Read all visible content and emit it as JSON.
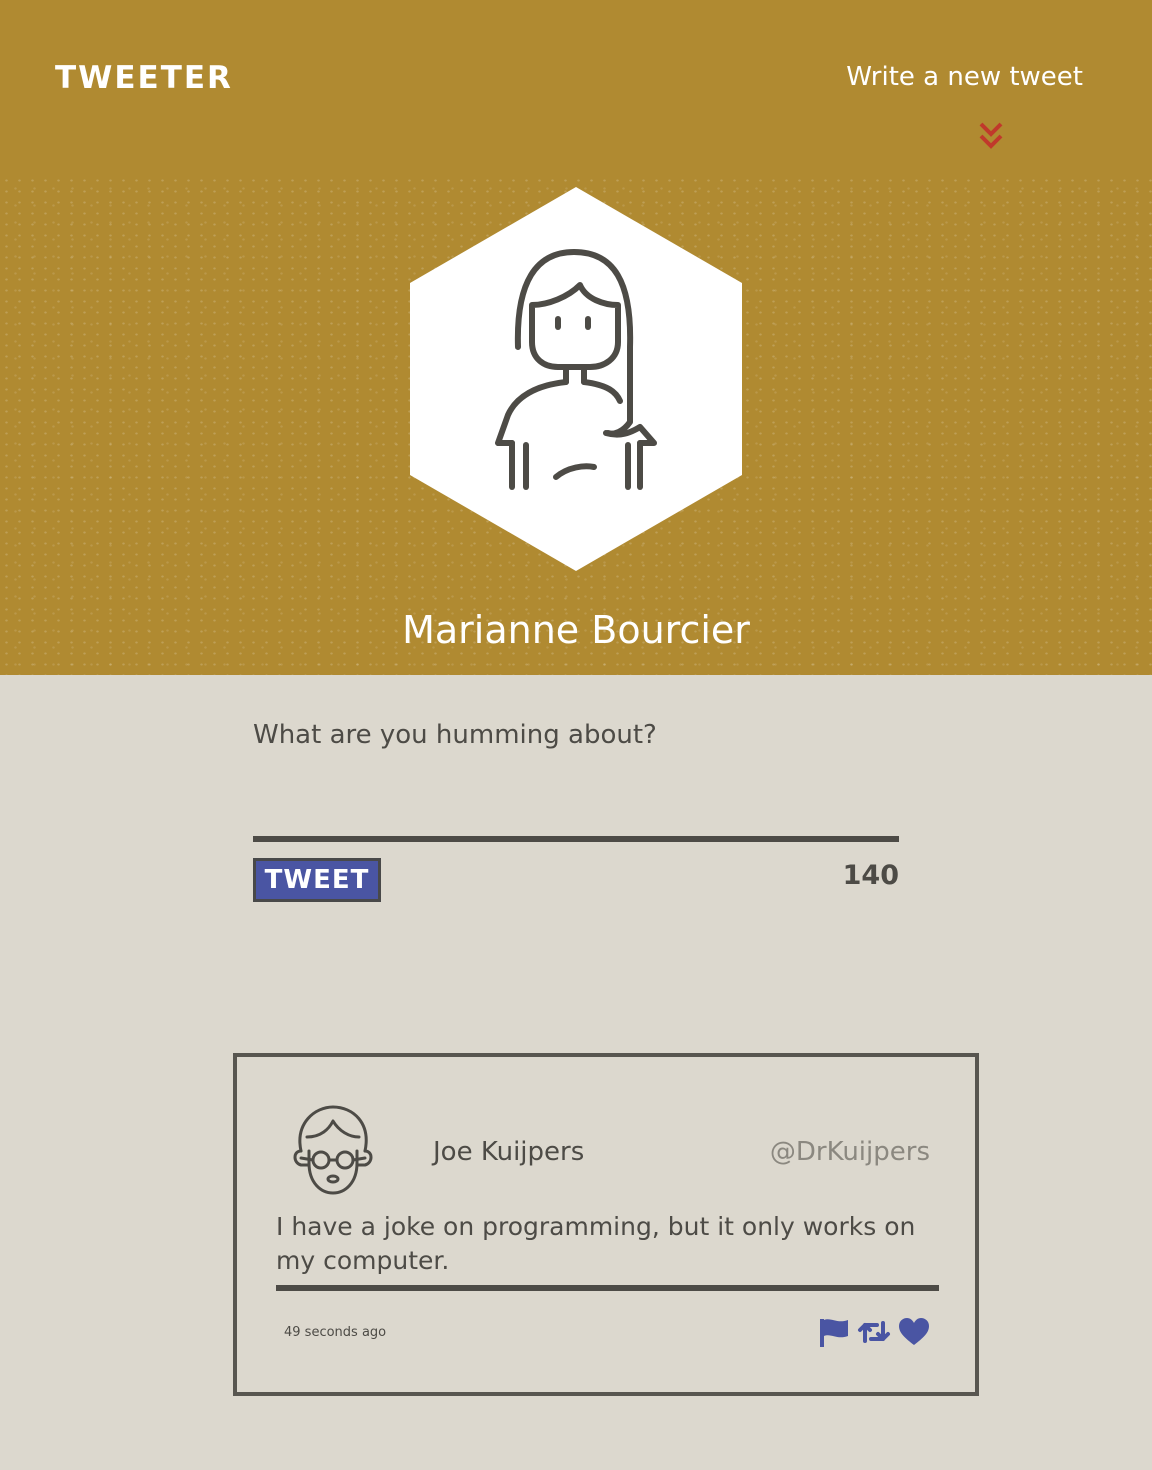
{
  "header": {
    "brand": "TWEETER",
    "compose_link": "Write a new tweet",
    "compose_toggle_icon": "double-chevron-down-icon",
    "accent_color": "#b08a31",
    "chevron_color": "#c0392b"
  },
  "profile": {
    "name": "Marianne Bourcier",
    "avatar_icon": "woman-avatar-icon"
  },
  "composer": {
    "placeholder": "What are you humming about?",
    "value": "",
    "submit_label": "TWEET",
    "char_counter": "140",
    "button_color": "#4a55a3"
  },
  "tweets": [
    {
      "author": "Joe Kuijpers",
      "handle": "@DrKuijpers",
      "avatar_icon": "man-glasses-avatar-icon",
      "text": "I have a joke on programming, but it only works on my computer.",
      "timestamp": "49 seconds ago",
      "actions": [
        "flag-icon",
        "retweet-icon",
        "heart-icon"
      ],
      "action_color": "#4a55a3"
    }
  ]
}
